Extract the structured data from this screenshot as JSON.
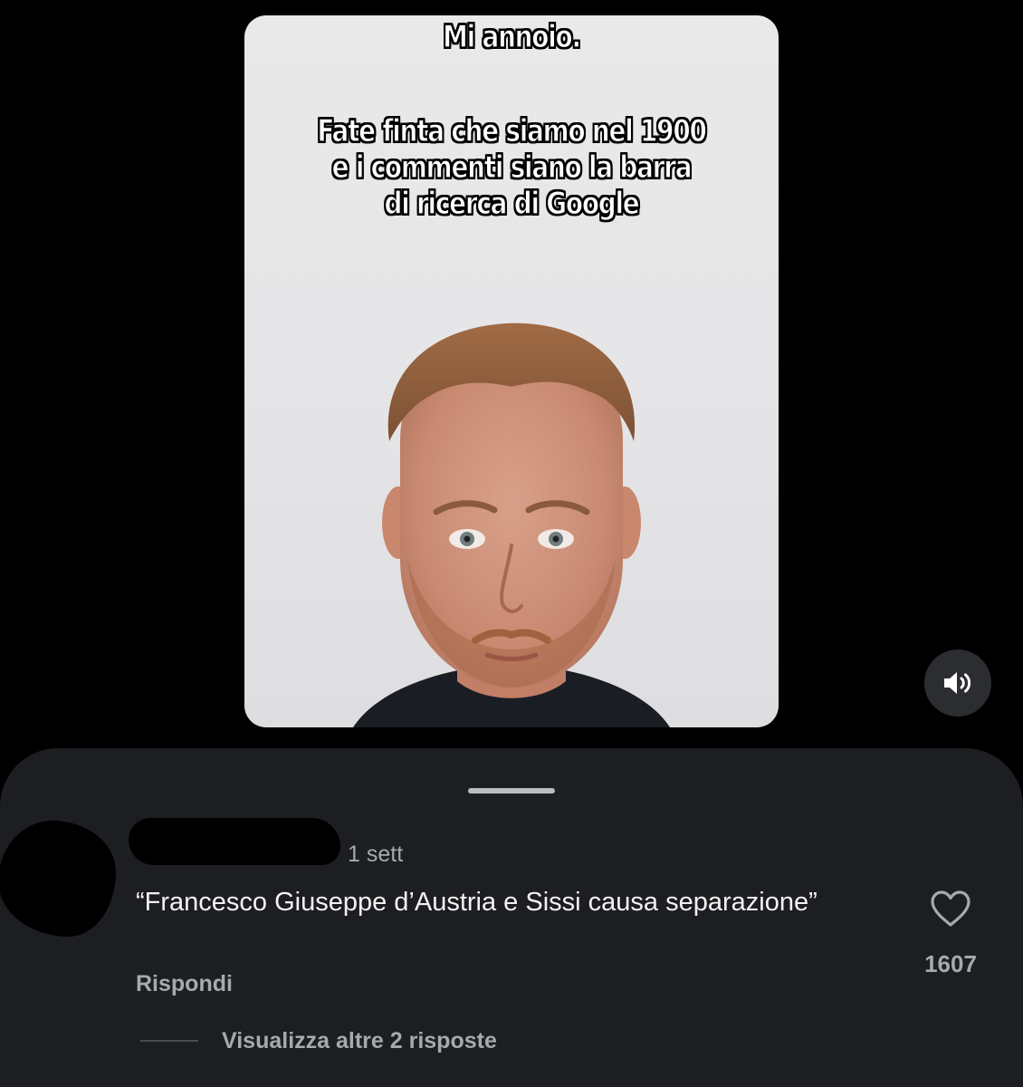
{
  "video": {
    "overlay_title": "Mi annoio.",
    "overlay_lines": [
      "Fate finta che siamo nel 1900",
      "e i commenti siano la barra",
      "di ricerca di Google"
    ],
    "sound_icon": "speaker-on-icon"
  },
  "comment": {
    "timestamp": "1 sett",
    "text": "“Francesco Giuseppe d’Austria e Sissi causa separazione”",
    "reply_label": "Rispondi",
    "like_icon": "heart-outline-icon",
    "like_count": "1607",
    "view_replies_label": "Visualizza altre 2 risposte"
  },
  "colors": {
    "background": "#000000",
    "sheet": "#1c1e21",
    "secondary_text": "#a7a9ae",
    "primary_text": "#f2f2f2"
  }
}
